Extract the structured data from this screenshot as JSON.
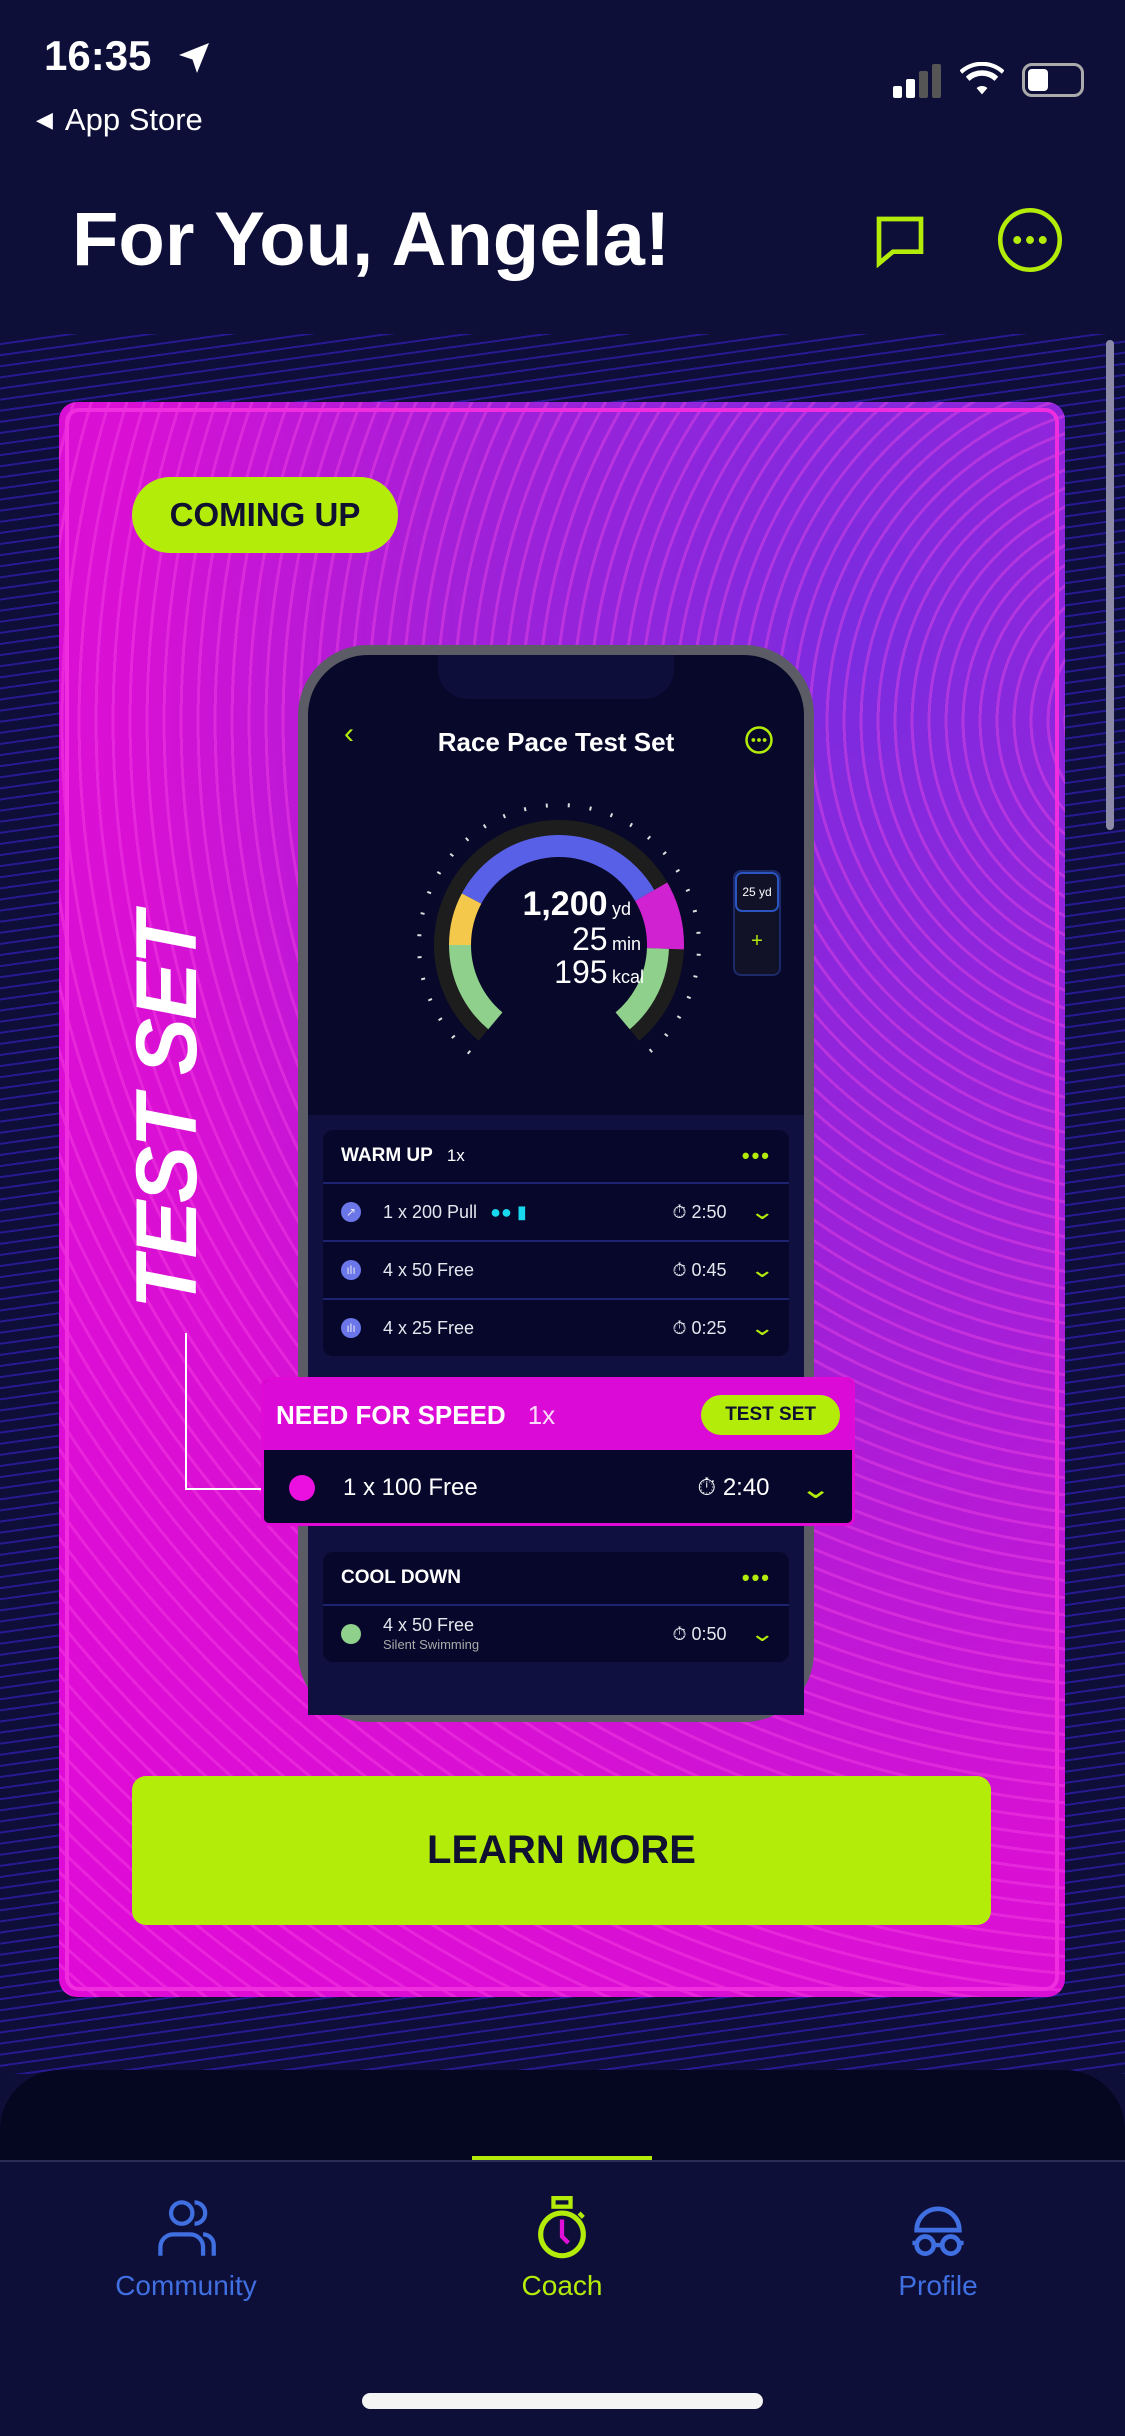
{
  "status": {
    "time": "16:35",
    "back_app": "App Store"
  },
  "header": {
    "title": "For You, Angela!"
  },
  "card": {
    "badge": "COMING UP",
    "side_title": "TEST SET",
    "cta": "LEARN MORE"
  },
  "phone": {
    "title": "Race Pace Test Set",
    "gauge": {
      "distance": "1,200",
      "distance_unit": "yd",
      "duration": "25",
      "duration_unit": "min",
      "calories": "195",
      "calories_unit": "kcal"
    },
    "pool_length": "25 yd",
    "warmup": {
      "name": "WARM UP",
      "reps": "1x",
      "rows": [
        {
          "label": "1 x 200 Pull",
          "time": "2:50"
        },
        {
          "label": "4 x 50 Free",
          "time": "0:45"
        },
        {
          "label": "4 x 25 Free",
          "time": "0:25"
        }
      ]
    },
    "cooldown": {
      "name": "COOL DOWN",
      "rows": [
        {
          "label": "4 x 50 Free",
          "sub": "Silent Swimming",
          "time": "0:50"
        }
      ]
    }
  },
  "highlight": {
    "name": "NEED FOR SPEED",
    "reps": "1x",
    "badge": "TEST SET",
    "row": {
      "label": "1 x 100 Free",
      "time": "2:40"
    }
  },
  "tabs": [
    {
      "label": "Community",
      "icon": "people-icon"
    },
    {
      "label": "Coach",
      "icon": "stopwatch-icon",
      "active": true
    },
    {
      "label": "Profile",
      "icon": "swim-cap-goggles-icon"
    }
  ],
  "colors": {
    "accent": "#b4ec0a",
    "magenta": "#dc0ad6",
    "background": "#0e0f38",
    "tab_inactive": "#3f6fe0"
  }
}
